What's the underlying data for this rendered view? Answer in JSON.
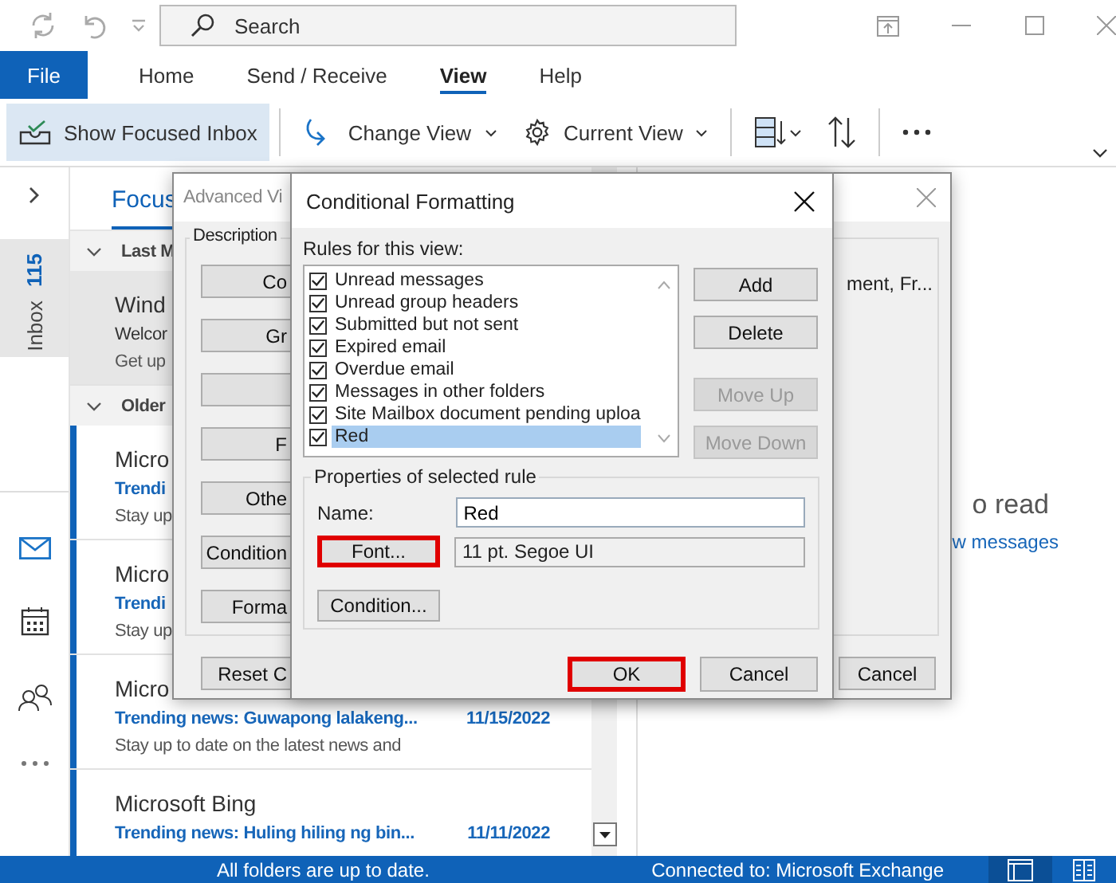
{
  "title_bar": {
    "search": {
      "placeholder": "Search"
    }
  },
  "ribbon_tabs": [
    {
      "label": "File",
      "kind": "backstage",
      "selected": false
    },
    {
      "label": "Home",
      "kind": "tab",
      "selected": false
    },
    {
      "label": "Send / Receive",
      "kind": "tab",
      "selected": false
    },
    {
      "label": "View",
      "kind": "tab",
      "selected": true
    },
    {
      "label": "Help",
      "kind": "tab",
      "selected": false
    }
  ],
  "toolbar": {
    "focused_inbox": {
      "label": "Show Focused Inbox",
      "on": true
    },
    "change_view": {
      "label": "Change View"
    },
    "current_view": {
      "label": "Current View"
    }
  },
  "nav_rail": {
    "folder": "Inbox",
    "count": "115",
    "selected": true
  },
  "message_list": {
    "tab": "Focus",
    "groups": [
      {
        "label": "Last M",
        "expanded": true,
        "messages": [
          {
            "sender": "Wind",
            "subject": "Welcor",
            "preview": "Get up",
            "selected": true,
            "unread": false
          }
        ]
      },
      {
        "label": "Older",
        "expanded": true,
        "messages": [
          {
            "sender": "Micro",
            "subject": "Trendi",
            "preview": "Stay up",
            "selected": false,
            "unread": true
          },
          {
            "sender": "Micro",
            "subject": "Trendi",
            "preview": "Stay up",
            "selected": false,
            "unread": true
          },
          {
            "sender": "Micro",
            "subject": "Trending news: Guwapong lalakeng...",
            "date": "11/15/2022",
            "preview": "Stay up to date on the latest news and",
            "selected": false,
            "unread": true
          },
          {
            "sender": "Microsoft Bing",
            "subject": "Trending news: Huling hiling ng bin...",
            "date": "11/11/2022",
            "selected": false,
            "unread": true
          }
        ]
      }
    ]
  },
  "reading_pane": {
    "heading": "o read",
    "link": "w messages"
  },
  "advanced_dialog": {
    "title": "Advanced Vi",
    "group": "Description",
    "buttons": [
      {
        "kind": "text",
        "label": "Co"
      },
      {
        "kind": "text",
        "label": "Gr"
      },
      {
        "kind": "blank"
      },
      {
        "kind": "text",
        "label": "F"
      },
      {
        "kind": "text",
        "label": "Othe"
      },
      {
        "kind": "text",
        "label": "Condition"
      },
      {
        "kind": "text",
        "label": "Forma"
      }
    ],
    "description": "ment, Fr...",
    "reset": "Reset C",
    "cancel": "Cancel"
  },
  "conditional_dialog": {
    "title": "Conditional Formatting",
    "rules_label": "Rules for this view:",
    "rules": [
      {
        "label": "Unread messages",
        "checked": true,
        "selected": false
      },
      {
        "label": "Unread group headers",
        "checked": true,
        "selected": false
      },
      {
        "label": "Submitted but not sent",
        "checked": true,
        "selected": false
      },
      {
        "label": "Expired email",
        "checked": true,
        "selected": false
      },
      {
        "label": "Overdue email",
        "checked": true,
        "selected": false
      },
      {
        "label": "Messages in other folders",
        "checked": true,
        "selected": false
      },
      {
        "label": "Site Mailbox document pending uploa",
        "checked": true,
        "selected": false
      },
      {
        "label": "Red",
        "checked": true,
        "selected": true
      }
    ],
    "side_buttons": [
      {
        "label": "Add",
        "disabled": false
      },
      {
        "label": "Delete",
        "disabled": false
      },
      {
        "label": "Move Up",
        "disabled": true
      },
      {
        "label": "Move Down",
        "disabled": true
      }
    ],
    "properties": {
      "title": "Properties of selected rule",
      "name_label": "Name:",
      "name_value": "Red",
      "font_button": {
        "label": "Font...",
        "highlighted": true
      },
      "font_value": "11 pt. Segoe UI",
      "condition_button": {
        "label": "Condition...",
        "highlighted": false
      }
    },
    "ok": {
      "label": "OK",
      "highlighted": true
    },
    "cancel": {
      "label": "Cancel",
      "highlighted": false
    }
  },
  "status_bar": {
    "left": "All folders are up to date.",
    "right": "Connected to: Microsoft Exchange"
  }
}
